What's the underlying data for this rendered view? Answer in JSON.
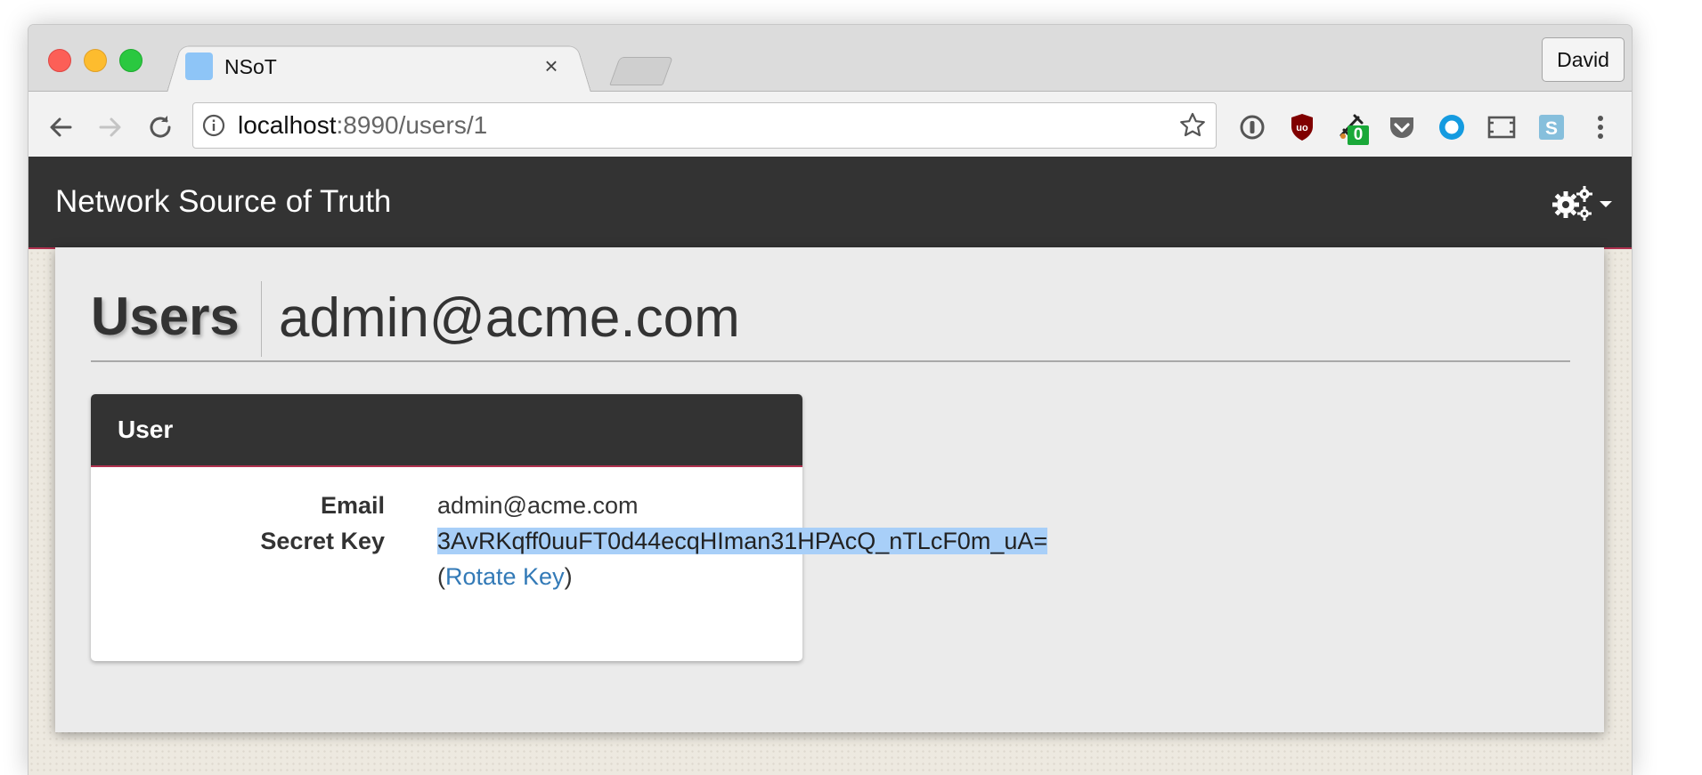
{
  "browser": {
    "tab": {
      "title": "NSoT",
      "close_glyph": "×"
    },
    "profile": "David",
    "url": {
      "host": "localhost",
      "rest": ":8990/users/1"
    },
    "extensions": {
      "badge_count": "0"
    }
  },
  "app": {
    "brand": "Network Source of Truth",
    "header": {
      "section": "Users",
      "title": "admin@acme.com"
    },
    "panel": {
      "title": "User",
      "fields": {
        "email_label": "Email",
        "email_value": "admin@acme.com",
        "key_label": "Secret Key",
        "key_value": "3AvRKqff0uuFT0d44ecqHIman31HPAcQ_nTLcF0m_uA=",
        "open_paren": "(",
        "rotate_link": "Rotate Key",
        "close_paren": ")"
      }
    }
  },
  "colors": {
    "navbar": "#333333",
    "accent": "#b1314f",
    "link": "#337ab7",
    "selection": "#a8cff8"
  },
  "icons": [
    "back-icon",
    "forward-icon",
    "reload-icon",
    "info-icon",
    "star-icon",
    "password-manager-icon",
    "ublock-icon",
    "cursor-extension-icon",
    "pocket-icon",
    "circle-extension-icon",
    "screenshot-icon",
    "s-extension-icon",
    "more-menu-icon",
    "gear-icon",
    "caret-down-icon"
  ]
}
